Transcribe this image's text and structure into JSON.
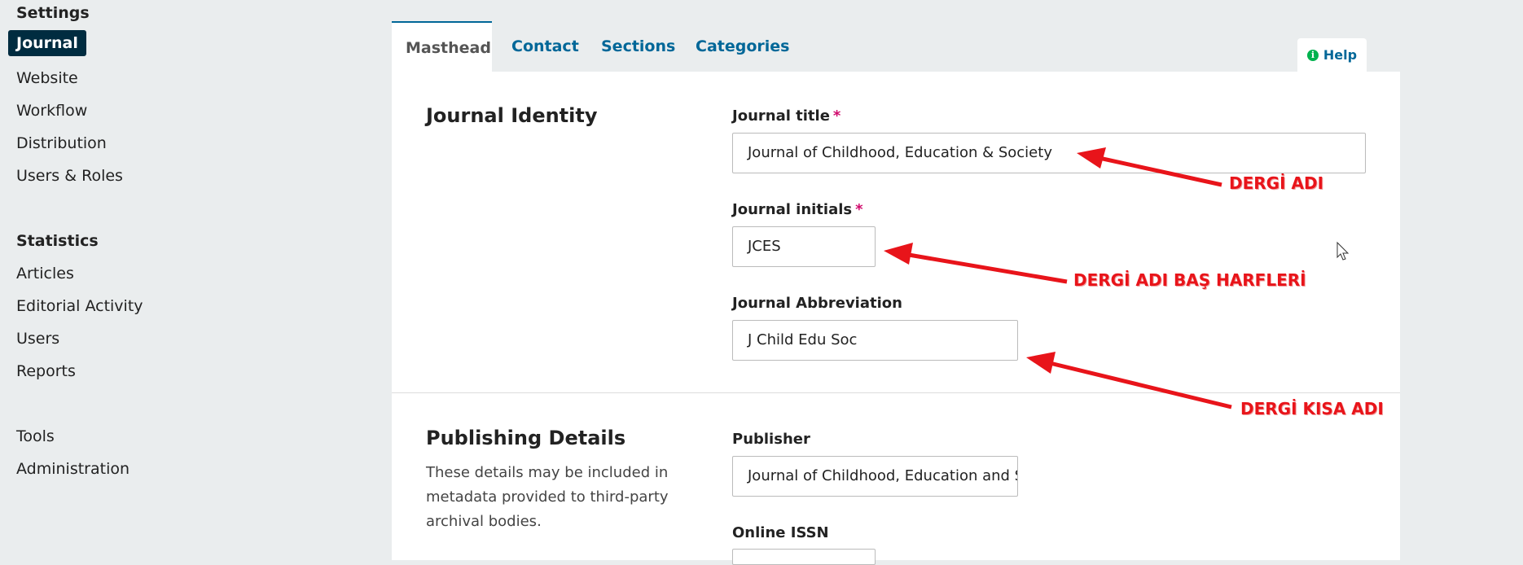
{
  "sidebar": {
    "settings_heading": "Settings",
    "settings_items": [
      "Journal",
      "Website",
      "Workflow",
      "Distribution",
      "Users & Roles"
    ],
    "statistics_heading": "Statistics",
    "statistics_items": [
      "Articles",
      "Editorial Activity",
      "Users",
      "Reports"
    ],
    "other_items": [
      "Tools",
      "Administration"
    ]
  },
  "tabs": [
    "Masthead",
    "Contact",
    "Sections",
    "Categories"
  ],
  "help": {
    "label": "Help",
    "icon": "info-icon"
  },
  "identity": {
    "title": "Journal Identity",
    "journal_title_label": "Journal title",
    "journal_title_value": "Journal of Childhood, Education & Society",
    "initials_label": "Journal initials",
    "initials_value": "JCES",
    "abbrev_label": "Journal Abbreviation",
    "abbrev_value": "J Child Edu Soc",
    "required_mark": "*"
  },
  "publishing": {
    "title": "Publishing Details",
    "description": "These details may be included in metadata provided to third-party archival bodies.",
    "publisher_label": "Publisher",
    "publisher_value": "Journal of Childhood, Education and Society",
    "online_issn_label": "Online ISSN"
  },
  "annotations": {
    "title_note": "DERGİ ADI",
    "initials_note": "DERGİ ADI BAŞ HARFLERİ",
    "abbrev_note": "DERGİ KISA ADI",
    "color": "#e8141a"
  },
  "colors": {
    "accent": "#006798",
    "active_nav_bg": "#002c40",
    "required": "#d00a6c",
    "page_bg": "#eaedee"
  }
}
